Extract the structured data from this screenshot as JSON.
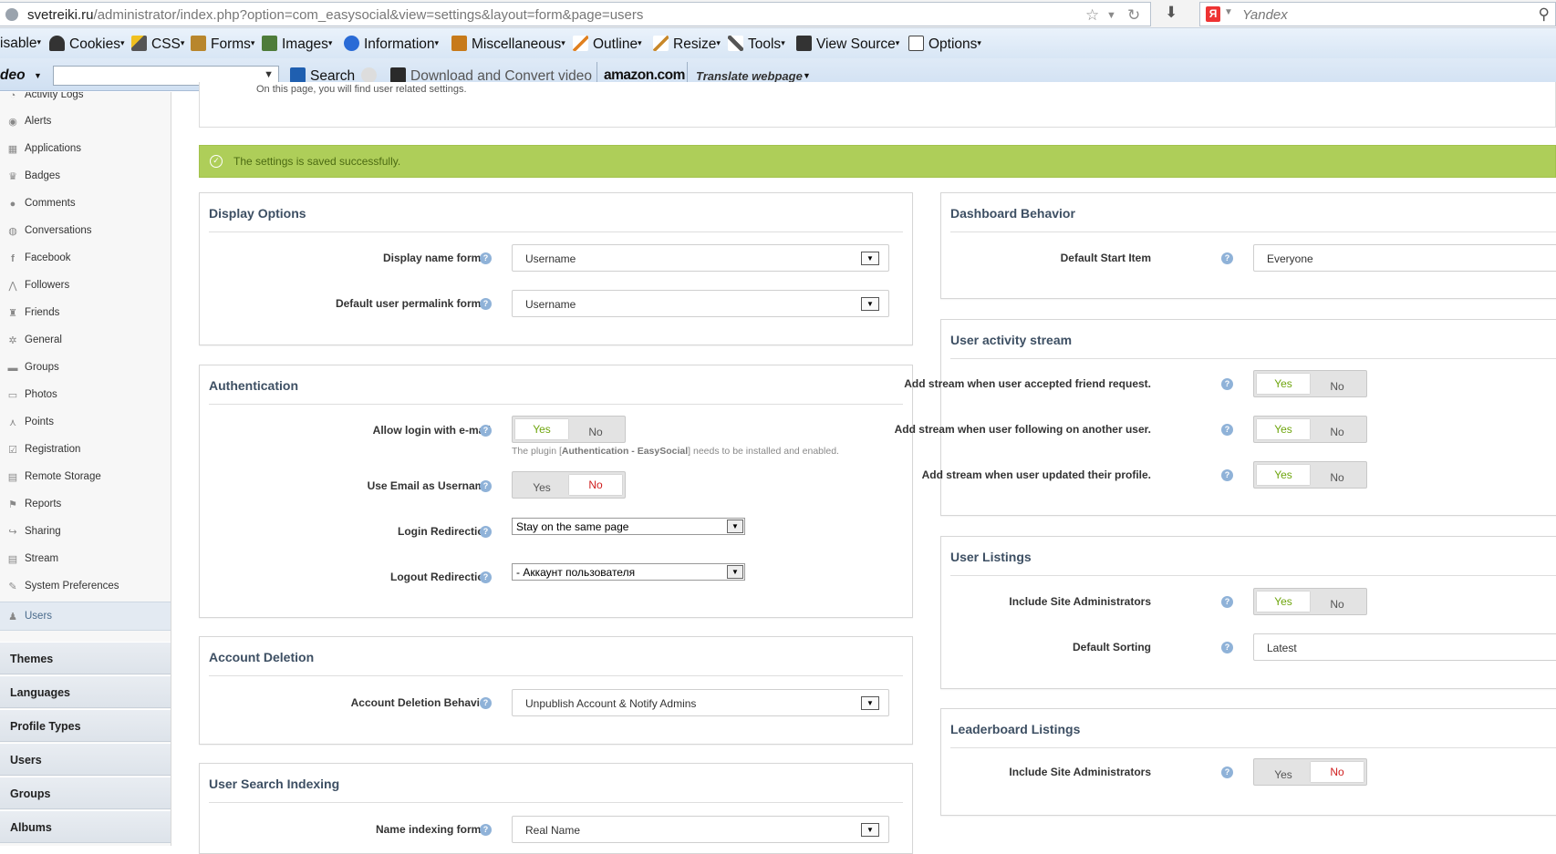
{
  "browser": {
    "url_host": "svetreiki.ru",
    "url_path": "/administrator/index.php?option=com_easysocial&view=settings&layout=form&page=users",
    "search_engine": "Yandex",
    "ya_logo": "Я"
  },
  "toolbar1": {
    "items": [
      "isable",
      "Cookies",
      "CSS",
      "Forms",
      "Images",
      "Information",
      "Miscellaneous",
      "Outline",
      "Resize",
      "Tools",
      "View Source",
      "Options"
    ]
  },
  "toolbar2": {
    "left_label": "deo",
    "search": "Search",
    "download": "Download and Convert video",
    "amazon": "amazon.com",
    "translate": "Translate webpage"
  },
  "sidebar": {
    "items": [
      {
        "label": "Activity Logs",
        "icon": "activity-icon"
      },
      {
        "label": "Alerts",
        "icon": "alerts-icon"
      },
      {
        "label": "Applications",
        "icon": "applications-icon"
      },
      {
        "label": "Badges",
        "icon": "badges-icon"
      },
      {
        "label": "Comments",
        "icon": "comments-icon"
      },
      {
        "label": "Conversations",
        "icon": "conversations-icon"
      },
      {
        "label": "Facebook",
        "icon": "facebook-icon"
      },
      {
        "label": "Followers",
        "icon": "followers-icon"
      },
      {
        "label": "Friends",
        "icon": "friends-icon"
      },
      {
        "label": "General",
        "icon": "gear-icon"
      },
      {
        "label": "Groups",
        "icon": "groups-icon"
      },
      {
        "label": "Photos",
        "icon": "photos-icon"
      },
      {
        "label": "Points",
        "icon": "points-icon"
      },
      {
        "label": "Registration",
        "icon": "registration-icon"
      },
      {
        "label": "Remote Storage",
        "icon": "storage-icon"
      },
      {
        "label": "Reports",
        "icon": "reports-icon"
      },
      {
        "label": "Sharing",
        "icon": "sharing-icon"
      },
      {
        "label": "Stream",
        "icon": "stream-icon"
      },
      {
        "label": "System Preferences",
        "icon": "wrench-icon"
      },
      {
        "label": "Users",
        "icon": "user-icon"
      }
    ],
    "sections": [
      "Themes",
      "Languages",
      "Profile Types",
      "Users",
      "Groups",
      "Albums"
    ]
  },
  "intro_text": "On this page, you will find user related settings.",
  "success_message": "The settings is saved successfully.",
  "display_options": {
    "title": "Display Options",
    "name_format_label": "Display name format",
    "name_format_value": "Username",
    "permalink_label": "Default user permalink format",
    "permalink_value": "Username"
  },
  "authentication": {
    "title": "Authentication",
    "allow_email_label": "Allow login with e-mail",
    "note_pre": "The plugin [",
    "note_bold": "Authentication - EasySocial",
    "note_post": "] needs to be installed and enabled.",
    "email_username_label": "Use Email as Username",
    "login_redirect_label": "Login Redirection",
    "login_redirect_value": "Stay on the same page",
    "logout_redirect_label": "Logout Redirection",
    "logout_redirect_value": "- Аккаунт пользователя"
  },
  "account_deletion": {
    "title": "Account Deletion",
    "behavior_label": "Account Deletion Behavior",
    "behavior_value": "Unpublish Account & Notify Admins"
  },
  "search_indexing": {
    "title": "User Search Indexing",
    "name_format_label": "Name indexing format",
    "name_format_value": "Real Name"
  },
  "dashboard": {
    "title": "Dashboard Behavior",
    "start_label": "Default Start Item",
    "start_value": "Everyone"
  },
  "activity_stream": {
    "title": "User activity stream",
    "friend_label": "Add stream when user accepted friend request.",
    "follow_label": "Add stream when user following on another user.",
    "profile_label": "Add stream when user updated their profile."
  },
  "listings": {
    "title": "User Listings",
    "admins_label": "Include Site Administrators",
    "sorting_label": "Default Sorting",
    "sorting_value": "Latest"
  },
  "leaderboard": {
    "title": "Leaderboard Listings",
    "admins_label": "Include Site Administrators"
  },
  "toggle": {
    "yes": "Yes",
    "no": "No"
  },
  "help_glyph": "?"
}
